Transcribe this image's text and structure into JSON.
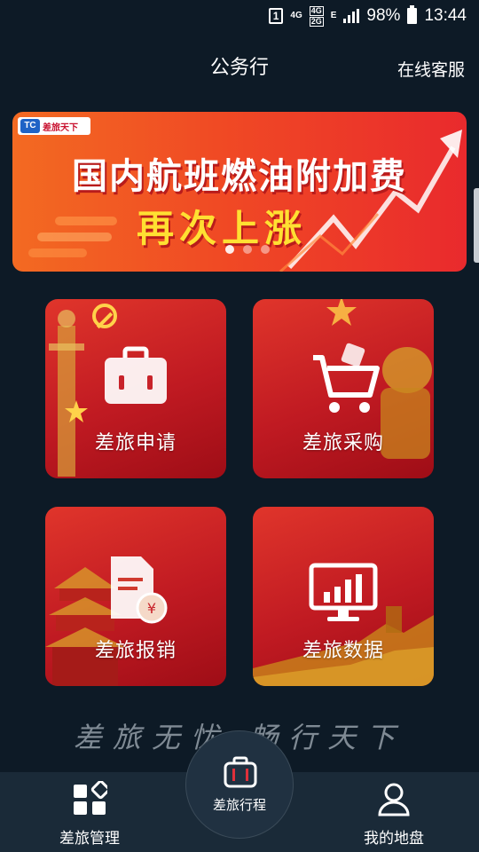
{
  "status_bar": {
    "sim": "1",
    "net1": "4G",
    "net2_top": "4G",
    "net2_bottom": "2G",
    "data_indicator": "E",
    "battery": "98%",
    "time": "13:44"
  },
  "header": {
    "title": "公务行",
    "service": "在线客服"
  },
  "banner": {
    "logo_mark": "TC",
    "logo_text": "差旅天下",
    "headline": "国内航班燃油附加费",
    "subheadline": "再次上涨",
    "slide_count": 3,
    "active_slide": 1
  },
  "tiles": [
    {
      "label": "差旅申请",
      "icon": "briefcase-icon"
    },
    {
      "label": "差旅采购",
      "icon": "shopping-cart-icon"
    },
    {
      "label": "差旅报销",
      "icon": "receipt-yuan-icon"
    },
    {
      "label": "差旅数据",
      "icon": "bar-chart-monitor-icon"
    }
  ],
  "slogan": "差旅无忧 畅行天下",
  "bottom_nav": {
    "left": {
      "label": "差旅管理",
      "icon": "grid-apps-icon"
    },
    "center": {
      "label": "差旅行程",
      "icon": "suitcase-icon"
    },
    "right": {
      "label": "我的地盘",
      "icon": "user-icon"
    }
  },
  "colors": {
    "background": "#0d1a26",
    "tile_red": "#c01a22",
    "banner_orange": "#f36a22",
    "banner_yellow": "#ffe032",
    "nav_bg": "#1a2a38"
  }
}
